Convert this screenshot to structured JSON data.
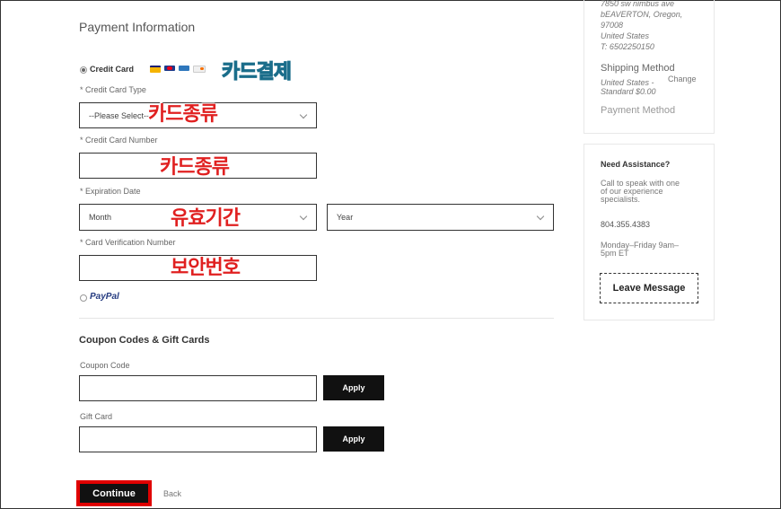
{
  "payment": {
    "title": "Payment Information",
    "credit_card_label": "Credit Card",
    "annotation_payment": "카드결제",
    "card_type_label": "* Credit Card Type",
    "card_type_value": "--Please Select--",
    "annotation_card_type": "카드종류",
    "card_number_label": "* Credit Card Number",
    "annotation_card_number": "카드종류",
    "expiration_label": "* Expiration Date",
    "month_value": "Month",
    "year_value": "Year",
    "annotation_expiration": "유효기간",
    "cvn_label": "* Card Verification Number",
    "annotation_cvn": "보안번호",
    "paypal_label": "PayPal"
  },
  "coupons": {
    "title": "Coupon Codes & Gift Cards",
    "coupon_label": "Coupon Code",
    "gift_label": "Gift Card",
    "apply_label": "Apply"
  },
  "actions": {
    "continue_label": "Continue",
    "back_label": "Back"
  },
  "summary": {
    "address_line1": "7850 sw nimbus ave",
    "address_line2": "bEAVERTON, Oregon,",
    "address_line3": "97008",
    "address_line4": "United States",
    "address_line5": "T: 6502250150",
    "shipping_title": "Shipping Method",
    "shipping_line1": "United States -",
    "shipping_line2": "Standard $0.00",
    "change_label": "Change",
    "payment_method": "Payment Method"
  },
  "assistance": {
    "title": "Need Assistance?",
    "line1": "Call to speak with one",
    "line2": "of our experience",
    "line3": "specialists.",
    "phone": "804.355.4383",
    "hours1": "Monday–Friday 9am–",
    "hours2": "5pm ET",
    "leave_message": "Leave Message"
  },
  "colors": {
    "accent_red": "#e00000",
    "button_black": "#111111"
  }
}
